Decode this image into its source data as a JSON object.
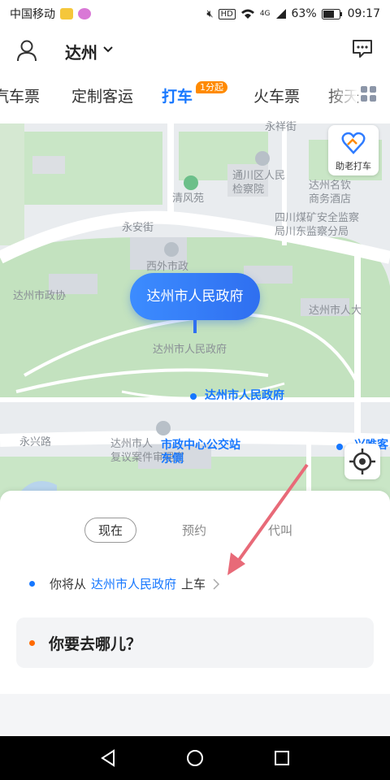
{
  "status_bar": {
    "carrier": "中国移动",
    "battery": "63%",
    "time": "09:17",
    "network": "4G",
    "hd": "HD"
  },
  "header": {
    "city": "达州",
    "user_icon": "user-icon",
    "message_icon": "message-icon"
  },
  "tabs": {
    "items": [
      "汽车票",
      "定制客运",
      "打车",
      "火车票",
      "按天"
    ],
    "active": "打车",
    "badge": "1分起"
  },
  "map": {
    "labels": {
      "yongxiang": "永祥街",
      "procuratorate": "通川区人民\n检察院",
      "hotel": "达州名钦\n商务酒店",
      "qingfeng": "清风苑",
      "safety": "四川煤矿安全监察\n局川东监察分局",
      "yongan": "永安街",
      "xiwai": "西外市政",
      "zhengxie": "达州市政协",
      "renda": "达州市人大",
      "gov_under_pin": "达州市人民政府",
      "gov_poi": "达州市人民政府",
      "yongxing": "永兴路",
      "fuyi": "达州市人\n复议案件审理室",
      "bus_stop": "市政中心公交站\n东侧",
      "right_edge": "兴唯客\n店"
    },
    "elder_button": "助老打车",
    "pin_label": "达州市人民政府"
  },
  "sheet": {
    "modes": [
      "现在",
      "预约",
      "代叫"
    ],
    "active_mode": "现在",
    "pickup_prefix": "你将从",
    "pickup_location": "达州市人民政府",
    "pickup_suffix": "上车",
    "destination_placeholder": "你要去哪儿？"
  },
  "colors": {
    "accent": "#1677ff",
    "badge": "#ff8a00",
    "dest_dot": "#ff6a00",
    "arrow": "#e86a78"
  }
}
